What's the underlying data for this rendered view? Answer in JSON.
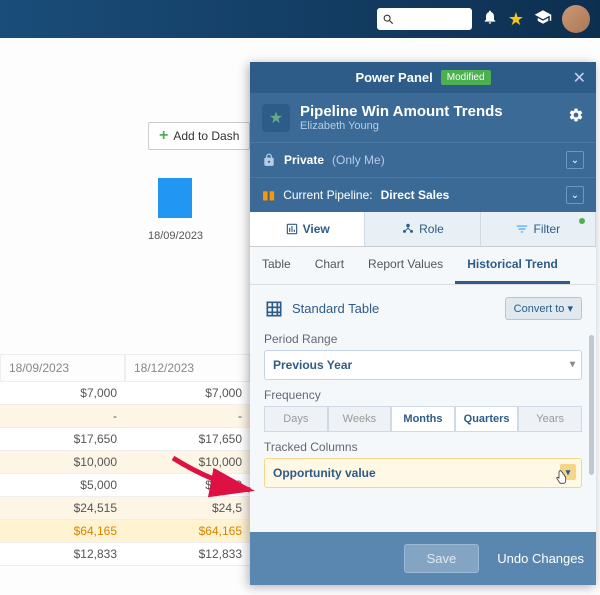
{
  "topbar": {
    "search_placeholder": ""
  },
  "dash_button": "Add to Dash",
  "bg_chart_date": "18/09/2023",
  "bg_table": {
    "headers": [
      "18/09/2023",
      "18/12/2023"
    ],
    "rows": [
      {
        "a": "$7,000",
        "b": "$7,000",
        "cls": ""
      },
      {
        "a": "-",
        "b": "-",
        "cls": "alt"
      },
      {
        "a": "$17,650",
        "b": "$17,650",
        "cls": ""
      },
      {
        "a": "$10,000",
        "b": "$10,000",
        "cls": "alt"
      },
      {
        "a": "$5,000",
        "b": "$5,000",
        "cls": ""
      },
      {
        "a": "$24,515",
        "b": "$24,5",
        "cls": "alt"
      },
      {
        "a": "$64,165",
        "b": "$64,165",
        "cls": "hl"
      },
      {
        "a": "$12,833",
        "b": "$12,833",
        "cls": ""
      }
    ]
  },
  "panel": {
    "header": "Power Panel",
    "badge": "Modified",
    "title": "Pipeline Win Amount Trends",
    "owner": "Elizabeth Young",
    "privacy_label": "Private",
    "privacy_scope": "(Only Me)",
    "pipeline_label": "Current Pipeline:",
    "pipeline_value": "Direct Sales",
    "tabs": {
      "view": "View",
      "role": "Role",
      "filter": "Filter"
    },
    "subtabs": {
      "table": "Table",
      "chart": "Chart",
      "report_values": "Report Values",
      "historical": "Historical Trend"
    },
    "table_type": "Standard Table",
    "convert": "Convert to",
    "period_label": "Period Range",
    "period_value": "Previous Year",
    "freq_label": "Frequency",
    "freq": {
      "days": "Days",
      "weeks": "Weeks",
      "months": "Months",
      "quarters": "Quarters",
      "years": "Years"
    },
    "tracked_label": "Tracked Columns",
    "tracked_value": "Opportunity value",
    "save": "Save",
    "undo": "Undo Changes"
  }
}
